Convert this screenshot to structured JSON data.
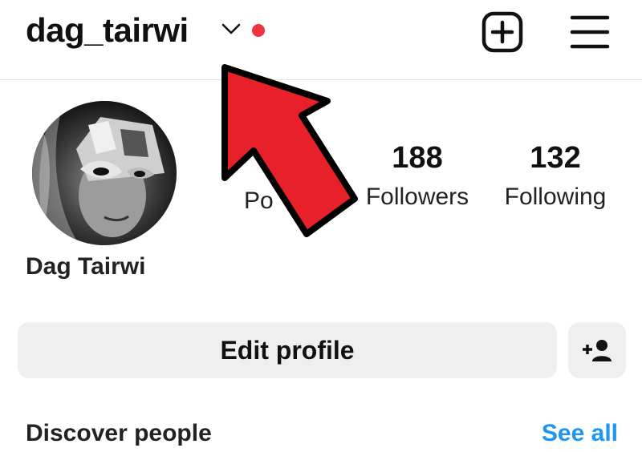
{
  "header": {
    "username": "dag_tairwi",
    "chevron_icon": "chevron-down-icon",
    "notification_dot_color": "#ef3340",
    "new_post_icon": "plus-square-icon",
    "menu_icon": "hamburger-menu-icon"
  },
  "profile": {
    "display_name": "Dag Tairwi",
    "stats": {
      "posts_label_visible": "Po",
      "followers_count": "188",
      "followers_label": "Followers",
      "following_count": "132",
      "following_label": "Following"
    }
  },
  "actions": {
    "edit_profile_label": "Edit profile",
    "add_person_icon": "add-person-icon"
  },
  "discover": {
    "title": "Discover people",
    "see_all_label": "See all",
    "see_all_color": "#1e95f0"
  },
  "annotation": {
    "arrow_color": "#e8202a"
  }
}
